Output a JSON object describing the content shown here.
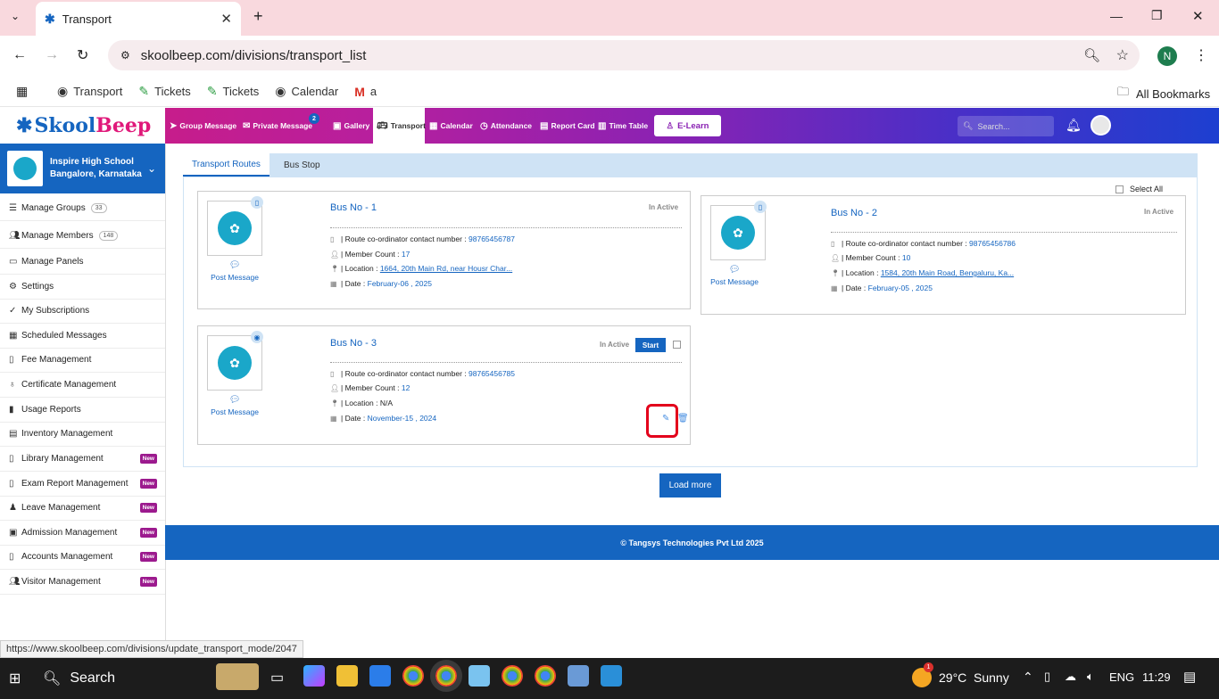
{
  "browser": {
    "tab_title": "Transport",
    "new_tab": "+",
    "url": "skoolbeep.com/divisions/transport_list",
    "profile_initial": "N",
    "bookmarks": [
      {
        "label": "Transport"
      },
      {
        "label": "Tickets"
      },
      {
        "label": "Tickets"
      },
      {
        "label": "Calendar"
      },
      {
        "label": "a"
      }
    ],
    "all_bookmarks": "All Bookmarks"
  },
  "app": {
    "logo_a": "Skool",
    "logo_b": "Beep",
    "nav": [
      {
        "label": "Group Message"
      },
      {
        "label": "Private Message",
        "badge": "2"
      },
      {
        "label": "Gallery"
      },
      {
        "label": "Transport"
      },
      {
        "label": "Calendar"
      },
      {
        "label": "Attendance"
      },
      {
        "label": "Report Card"
      },
      {
        "label": "Time Table"
      }
    ],
    "elearn": "E-Learn",
    "search_placeholder": "Search..."
  },
  "school": {
    "name": "Inspire High School",
    "location": "Bangalore, Karnataka"
  },
  "sidebar": [
    {
      "label": "Manage Groups",
      "count": "33"
    },
    {
      "label": "Manage Members",
      "count": "148"
    },
    {
      "label": "Manage Panels"
    },
    {
      "label": "Settings"
    },
    {
      "label": "My Subscriptions"
    },
    {
      "label": "Scheduled Messages"
    },
    {
      "label": "Fee Management"
    },
    {
      "label": "Certificate Management"
    },
    {
      "label": "Usage Reports"
    },
    {
      "label": "Inventory Management"
    },
    {
      "label": "Library Management",
      "badge": "New"
    },
    {
      "label": "Exam Report Management",
      "badge": "New"
    },
    {
      "label": "Leave Management",
      "badge": "New"
    },
    {
      "label": "Admission Management",
      "badge": "New"
    },
    {
      "label": "Accounts Management",
      "badge": "New"
    },
    {
      "label": "Visitor Management",
      "badge": "New"
    }
  ],
  "tabs": [
    "Transport Routes",
    "Bus Stop"
  ],
  "select_all": "Select All",
  "labels": {
    "coordinator": "| Route co-ordinator contact number :",
    "members": "| Member Count :",
    "location": "| Location :",
    "date": "| Date :",
    "post_message": "Post Message",
    "inactive": "In Active",
    "start": "Start"
  },
  "buses": [
    {
      "title": "Bus No - 1",
      "phone": "98765456787",
      "members": "17",
      "location": "1664, 20th Main Rd, near Housr Char...",
      "date": "February-06 , 2025"
    },
    {
      "title": "Bus No - 2",
      "phone": "98765456786",
      "members": "10",
      "location": "1584, 20th Main Road, Bengaluru, Ka...",
      "date": "February-05 , 2025"
    },
    {
      "title": "Bus No - 3",
      "phone": "98765456785",
      "members": "12",
      "location": "N/A",
      "date": "November-15 , 2024"
    }
  ],
  "load_more": "Load more",
  "footer": "© Tangsys Technologies Pvt Ltd 2025",
  "status_url": "https://www.skoolbeep.com/divisions/update_transport_mode/2047",
  "taskbar": {
    "search": "Search",
    "weather_temp": "29°C",
    "weather_desc": "Sunny",
    "lang": "ENG",
    "time": "11:29",
    "weather_badge": "1"
  }
}
